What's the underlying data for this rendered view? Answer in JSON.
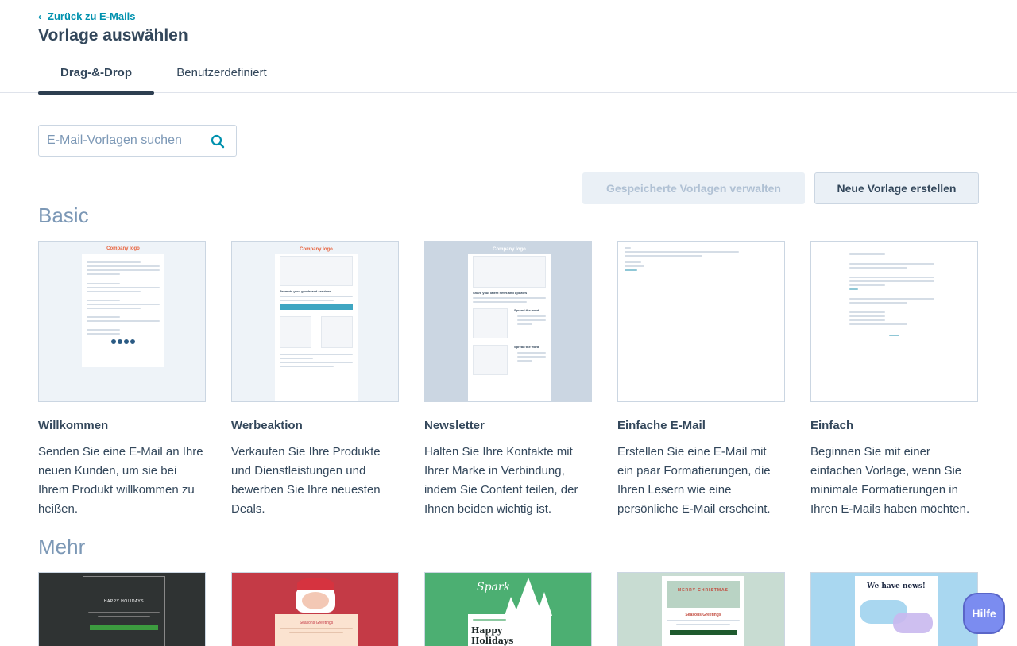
{
  "header": {
    "back_label": "Zurück zu E-Mails",
    "title": "Vorlage auswählen",
    "tabs": [
      {
        "label": "Drag-&-Drop"
      },
      {
        "label": "Benutzerdefiniert"
      }
    ]
  },
  "search": {
    "placeholder": "E-Mail-Vorlagen suchen",
    "value": ""
  },
  "actions": {
    "manage_label": "Gespeicherte Vorlagen verwalten",
    "new_label": "Neue Vorlage erstellen"
  },
  "sections": {
    "basic": {
      "title": "Basic",
      "cards": [
        {
          "title": "Willkommen",
          "desc": "Senden Sie eine E-Mail an Ihre neuen Kunden, um sie bei Ihrem Produkt willkommen zu heißen.",
          "logo": "Company logo"
        },
        {
          "title": "Werbeaktion",
          "desc": "Verkaufen Sie Ihre Produkte und Dienstleistungen und bewerben Sie Ihre neuesten Deals.",
          "logo": "Company logo",
          "heading": "Promote your goods and services"
        },
        {
          "title": "Newsletter",
          "desc": "Halten Sie Ihre Kontakte mit Ihrer Marke in Verbindung, indem Sie Content teilen, der Ihnen beiden wichtig ist.",
          "logo": "Company logo",
          "heading": "Share your latest news and updates",
          "sub1": "Spread the word",
          "sub2": "Spread the word"
        },
        {
          "title": "Einfache E-Mail",
          "desc": "Erstellen Sie eine E-Mail mit ein paar Formatierungen, die Ihren Lesern wie eine persönliche E-Mail erscheint."
        },
        {
          "title": "Einfach",
          "desc": "Beginnen Sie mit einer einfachen Vorlage, wenn Sie minimale Formatierungen in Ihren E-Mails haben möchten."
        }
      ]
    },
    "more": {
      "title": "Mehr",
      "cards": [
        {
          "thumb_text": "HAPPY HOLIDAYS"
        },
        {
          "thumb_text": "Seasons Greetings"
        },
        {
          "thumb_text": "Happy Holidays",
          "brand": "Spark"
        },
        {
          "thumb_text": "MERRY CHRISTMAS",
          "sub": "Seasons Greetings"
        },
        {
          "thumb_text": "We have news!"
        }
      ]
    }
  },
  "help": {
    "label": "Hilfe"
  },
  "colors": {
    "accent_link": "#0091ae",
    "text": "#33475b",
    "section": "#7c98b6"
  }
}
